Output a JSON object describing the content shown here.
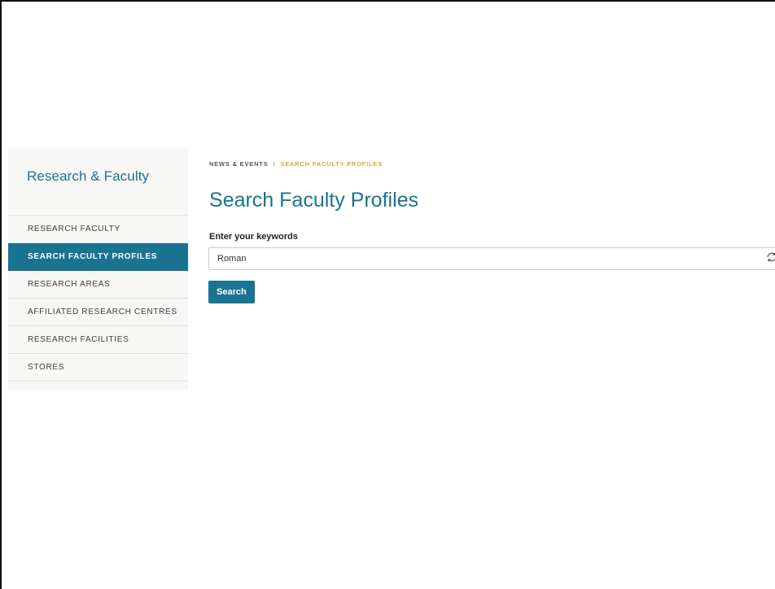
{
  "sidebar": {
    "title": "Research & Faculty",
    "items": [
      {
        "label": "RESEARCH FACULTY",
        "active": false
      },
      {
        "label": "SEARCH FACULTY PROFILES",
        "active": true
      },
      {
        "label": "RESEARCH AREAS",
        "active": false
      },
      {
        "label": "AFFILIATED RESEARCH CENTRES",
        "active": false
      },
      {
        "label": "RESEARCH FACILITIES",
        "active": false
      },
      {
        "label": "STORES",
        "active": false
      }
    ]
  },
  "breadcrumb": {
    "parent": "NEWS & EVENTS",
    "separator": "/",
    "current": "SEARCH FACULTY PROFILES"
  },
  "main": {
    "title": "Search Faculty Profiles",
    "form": {
      "label": "Enter your keywords",
      "input_value": "Roman",
      "input_placeholder": "",
      "refresh_icon": "refresh-icon",
      "submit_label": "Search"
    }
  },
  "colors": {
    "accent": "#1a7390",
    "breadcrumb_current": "#d9a33b",
    "sidebar_bg": "#f7f7f5"
  }
}
